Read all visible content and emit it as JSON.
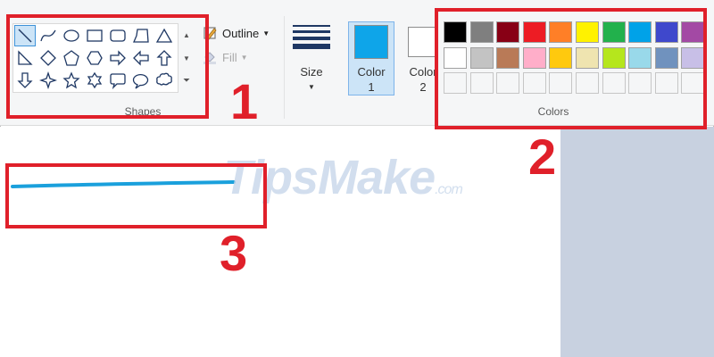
{
  "ribbon": {
    "shapes_group_label": "Shapes",
    "outline_label": "Outline",
    "fill_label": "Fill",
    "size_label": "Size",
    "color1_label": "Color",
    "color1_num": "1",
    "color2_label": "Color",
    "color2_num": "2",
    "colors_group_label": "Colors",
    "color1_value": "#0ea5e9",
    "color2_value": "#ffffff"
  },
  "shapes": [
    "line",
    "curve",
    "oval",
    "rectangle",
    "rounded-rectangle",
    "polygon",
    "triangle",
    "right-triangle",
    "diamond",
    "pentagon",
    "hexagon",
    "right-arrow",
    "left-arrow",
    "up-arrow",
    "down-arrow",
    "four-point-star",
    "five-point-star",
    "six-point-star",
    "rounded-callout",
    "oval-callout",
    "cloud-callout"
  ],
  "palette": {
    "row1": [
      "#000000",
      "#7f7f7f",
      "#880015",
      "#ed1c24",
      "#ff7f27",
      "#fff200",
      "#22b14c",
      "#00a2e8",
      "#3f48cc",
      "#a349a4"
    ],
    "row2": [
      "#ffffff",
      "#c3c3c3",
      "#b97a57",
      "#ffaec9",
      "#ffc90e",
      "#efe4b0",
      "#b5e61d",
      "#99d9ea",
      "#7092be",
      "#c8bfe7"
    ],
    "row3_empty_count": 10
  },
  "callouts": {
    "one": "1",
    "two": "2",
    "three": "3"
  },
  "watermark": {
    "main": "TipsMake",
    "suffix": ".com"
  }
}
